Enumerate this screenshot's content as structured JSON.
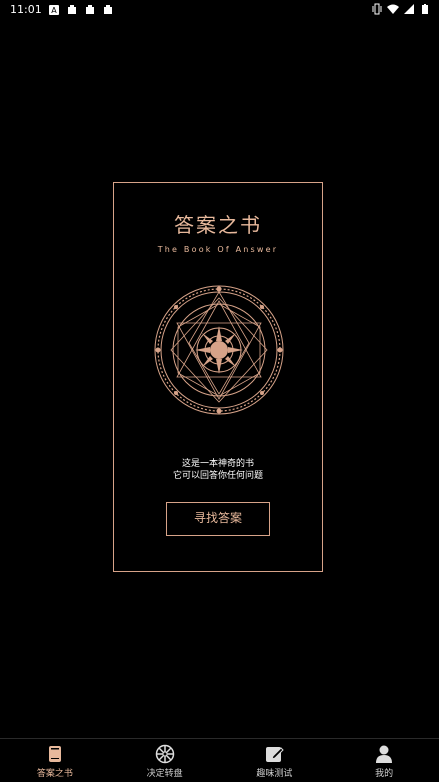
{
  "status_bar": {
    "time": "11:01",
    "icons_left": [
      "a-badge-icon",
      "bug-icon",
      "bug-icon",
      "bug-icon"
    ],
    "icons_right": [
      "vibrate-icon",
      "wifi-icon",
      "signal-icon",
      "battery-icon"
    ]
  },
  "card": {
    "title": "答案之书",
    "subtitle": "The  Book  Of  Answer",
    "line1": "这是一本神奇的书",
    "line2": "它可以回答你任何问题",
    "button_label": "寻找答案"
  },
  "bottom_nav": {
    "items": [
      {
        "label": "答案之书",
        "icon": "book-icon",
        "active": true
      },
      {
        "label": "决定转盘",
        "icon": "wheel-icon",
        "active": false
      },
      {
        "label": "趣味测试",
        "icon": "edit-icon",
        "active": false
      },
      {
        "label": "我的",
        "icon": "user-icon",
        "active": false
      }
    ]
  },
  "colors": {
    "accent": "#e8b99c",
    "border": "#d7a389",
    "background": "#000000"
  }
}
